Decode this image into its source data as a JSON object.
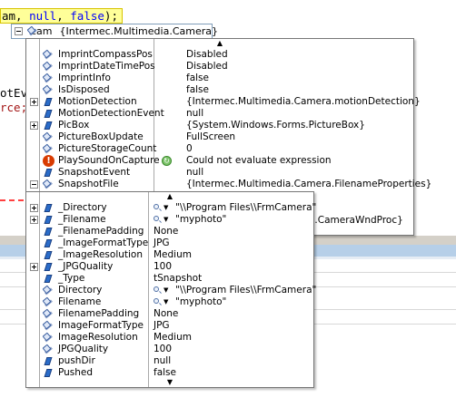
{
  "editor": {
    "code_line_prefix": "am, ",
    "code_line_kw1": "null",
    "code_line_mid": ", ",
    "code_line_kw2": "false",
    "code_line_suffix": ");",
    "fragment1": "otEv",
    "fragment2": "rce;"
  },
  "watch": {
    "name": "cam",
    "value": "{Intermec.Multimedia.Camera}"
  },
  "camera_properties": [
    {
      "name": "ImprintCompassPos",
      "value": "Disabled",
      "icon": "property-icon",
      "expandable": false
    },
    {
      "name": "ImprintDateTimePos",
      "value": "Disabled",
      "icon": "property-icon",
      "expandable": false
    },
    {
      "name": "ImprintInfo",
      "value": "false",
      "icon": "property-icon",
      "expandable": false
    },
    {
      "name": "IsDisposed",
      "value": "false",
      "icon": "property-icon",
      "expandable": false
    },
    {
      "name": "MotionDetection",
      "value": "{Intermec.Multimedia.Camera.motionDetection}",
      "icon": "field-icon",
      "expandable": true
    },
    {
      "name": "MotionDetectionEvent",
      "value": "null",
      "icon": "field-icon",
      "expandable": false
    },
    {
      "name": "PicBox",
      "value": "{System.Windows.Forms.PictureBox}",
      "icon": "field-icon",
      "expandable": true
    },
    {
      "name": "PictureBoxUpdate",
      "value": "FullScreen",
      "icon": "property-icon",
      "expandable": false
    },
    {
      "name": "PictureStorageCount",
      "value": "0",
      "icon": "property-icon",
      "expandable": false
    },
    {
      "name": "PlaySoundOnCapture",
      "value": "Could not evaluate expression",
      "icon": "error-icon",
      "expandable": false,
      "refresh": true
    },
    {
      "name": "SnapshotEvent",
      "value": "null",
      "icon": "field-icon",
      "expandable": false
    },
    {
      "name": "SnapshotFile",
      "value": "{Intermec.Multimedia.Camera.FilenameProperties}",
      "icon": "property-icon",
      "expandable": true,
      "expanded": true
    }
  ],
  "hidden_row_value_tail": "a.CameraWndProc}",
  "snapshot_file_properties": [
    {
      "name": "_Directory",
      "value": "\"\\\\Program Files\\\\FrmCamera\"",
      "icon": "field-icon",
      "expandable": true,
      "magnifier": true
    },
    {
      "name": "_Filename",
      "value": "\"myphoto\"",
      "icon": "field-icon",
      "expandable": true,
      "magnifier": true
    },
    {
      "name": "_FilenamePadding",
      "value": "None",
      "icon": "field-icon",
      "expandable": false
    },
    {
      "name": "_ImageFormatType",
      "value": "JPG",
      "icon": "field-icon",
      "expandable": false
    },
    {
      "name": "_ImageResolution",
      "value": "Medium",
      "icon": "field-icon",
      "expandable": false
    },
    {
      "name": "_JPGQuality",
      "value": "100",
      "icon": "field-icon",
      "expandable": true
    },
    {
      "name": "_Type",
      "value": "tSnapshot",
      "icon": "field-icon",
      "expandable": false
    },
    {
      "name": "Directory",
      "value": "\"\\\\Program Files\\\\FrmCamera\"",
      "icon": "property-icon",
      "expandable": false,
      "magnifier": true
    },
    {
      "name": "Filename",
      "value": "\"myphoto\"",
      "icon": "property-icon",
      "expandable": false,
      "magnifier": true
    },
    {
      "name": "FilenamePadding",
      "value": "None",
      "icon": "property-icon",
      "expandable": false
    },
    {
      "name": "ImageFormatType",
      "value": "JPG",
      "icon": "property-icon",
      "expandable": false
    },
    {
      "name": "ImageResolution",
      "value": "Medium",
      "icon": "property-icon",
      "expandable": false
    },
    {
      "name": "JPGQuality",
      "value": "100",
      "icon": "property-icon",
      "expandable": false
    },
    {
      "name": "pushDir",
      "value": "null",
      "icon": "field-icon",
      "expandable": false
    },
    {
      "name": "Pushed",
      "value": "false",
      "icon": "field-icon",
      "expandable": false
    }
  ],
  "scroll": {
    "up_glyph": "▲",
    "down_glyph": "▼"
  }
}
